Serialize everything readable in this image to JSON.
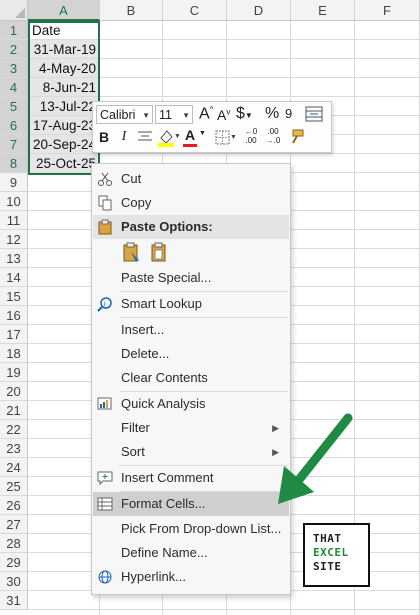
{
  "columns": [
    "A",
    "B",
    "C",
    "D",
    "E",
    "F"
  ],
  "rows": [
    "1",
    "2",
    "3",
    "4",
    "5",
    "6",
    "7",
    "8",
    "9",
    "10",
    "11",
    "12",
    "13",
    "14",
    "15",
    "16",
    "17",
    "18",
    "19",
    "20",
    "21",
    "22",
    "23",
    "24",
    "25",
    "26",
    "27",
    "28",
    "29",
    "30",
    "31"
  ],
  "cells": {
    "A1": "Date",
    "A2": "31-Mar-19",
    "A3": "4-May-20",
    "A4": "8-Jun-21",
    "A5": "13-Jul-22",
    "A6": "17-Aug-23",
    "A7": "20-Sep-24",
    "A8": "25-Oct-25"
  },
  "mini_toolbar": {
    "font_name": "Calibri",
    "font_size": "11",
    "bold_label": "B",
    "italic_label": "I",
    "currency_label": "$",
    "percent_label": "%",
    "grow_font_label": "A",
    "shrink_font_label": "A",
    "font_color_label": "A",
    "font_color": "#e41e1e",
    "highlight_color": "#ffff00",
    "inc_decimal_label": ".00",
    "dec_decimal_label": ".00"
  },
  "context_menu": {
    "cut": "Cut",
    "copy": "Copy",
    "paste_options": "Paste Options:",
    "paste_special": "Paste Special...",
    "smart_lookup": "Smart Lookup",
    "insert": "Insert...",
    "delete": "Delete...",
    "clear_contents": "Clear Contents",
    "quick_analysis": "Quick Analysis",
    "filter": "Filter",
    "sort": "Sort",
    "insert_comment": "Insert Comment",
    "format_cells": "Format Cells...",
    "pick_from_dropdown": "Pick From Drop-down List...",
    "define_name": "Define Name...",
    "hyperlink": "Hyperlink..."
  },
  "logo": {
    "line1": "THAT",
    "line2": "EXCEL",
    "line3": "SITE"
  },
  "colors": {
    "selection": "#217346",
    "arrow": "#1f8a43"
  }
}
